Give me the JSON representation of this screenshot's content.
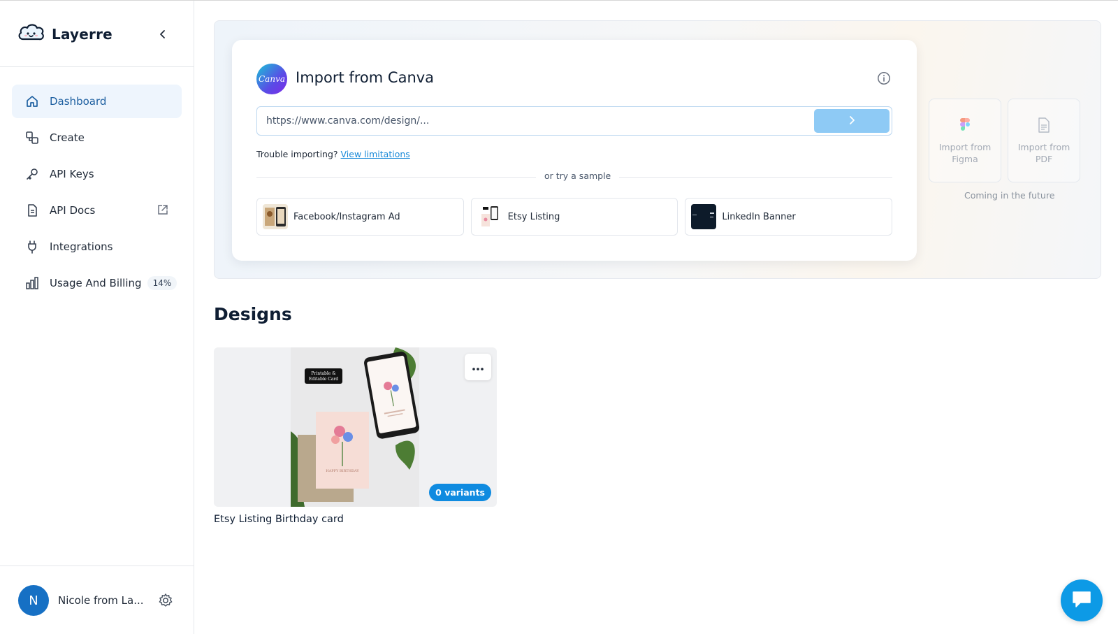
{
  "brand": {
    "name": "Layerre"
  },
  "sidebar": {
    "items": [
      {
        "label": "Dashboard",
        "icon": "home-icon",
        "active": true
      },
      {
        "label": "Create",
        "icon": "shapes-icon"
      },
      {
        "label": "API Keys",
        "icon": "key-icon"
      },
      {
        "label": "API Docs",
        "icon": "document-icon",
        "external": true
      },
      {
        "label": "Integrations",
        "icon": "plug-icon"
      },
      {
        "label": "Usage And Billing",
        "icon": "bar-chart-icon",
        "badge": "14%"
      }
    ],
    "user": {
      "initial": "N",
      "name": "Nicole from La..."
    }
  },
  "import": {
    "title": "Import from Canva",
    "canva_logo_text": "Canva",
    "url_placeholder": "https://www.canva.com/design/...",
    "trouble_text": "Trouble importing?",
    "trouble_link": "View limitations",
    "divider_text": "or try a sample",
    "samples": [
      {
        "label": "Facebook/Instagram Ad"
      },
      {
        "label": "Etsy Listing"
      },
      {
        "label": "LinkedIn Banner"
      }
    ],
    "future": {
      "figma_line1": "Import from",
      "figma_line2": "Figma",
      "pdf_line1": "Import from",
      "pdf_line2": "PDF",
      "label": "Coming in the future"
    }
  },
  "designs": {
    "title": "Designs",
    "items": [
      {
        "name": "Etsy Listing Birthday card",
        "variants": "0 variants",
        "card_tag_line1": "Printable &",
        "card_tag_line2": "Editable Card",
        "card_caption": "HAPPY BIRTHDAY"
      }
    ]
  },
  "colors": {
    "accent": "#1670c4",
    "active_bg": "#eef5fd",
    "go_button": "#8ecaf5",
    "variants_badge": "#0f8be0",
    "chat_button": "#0d9ae6"
  }
}
